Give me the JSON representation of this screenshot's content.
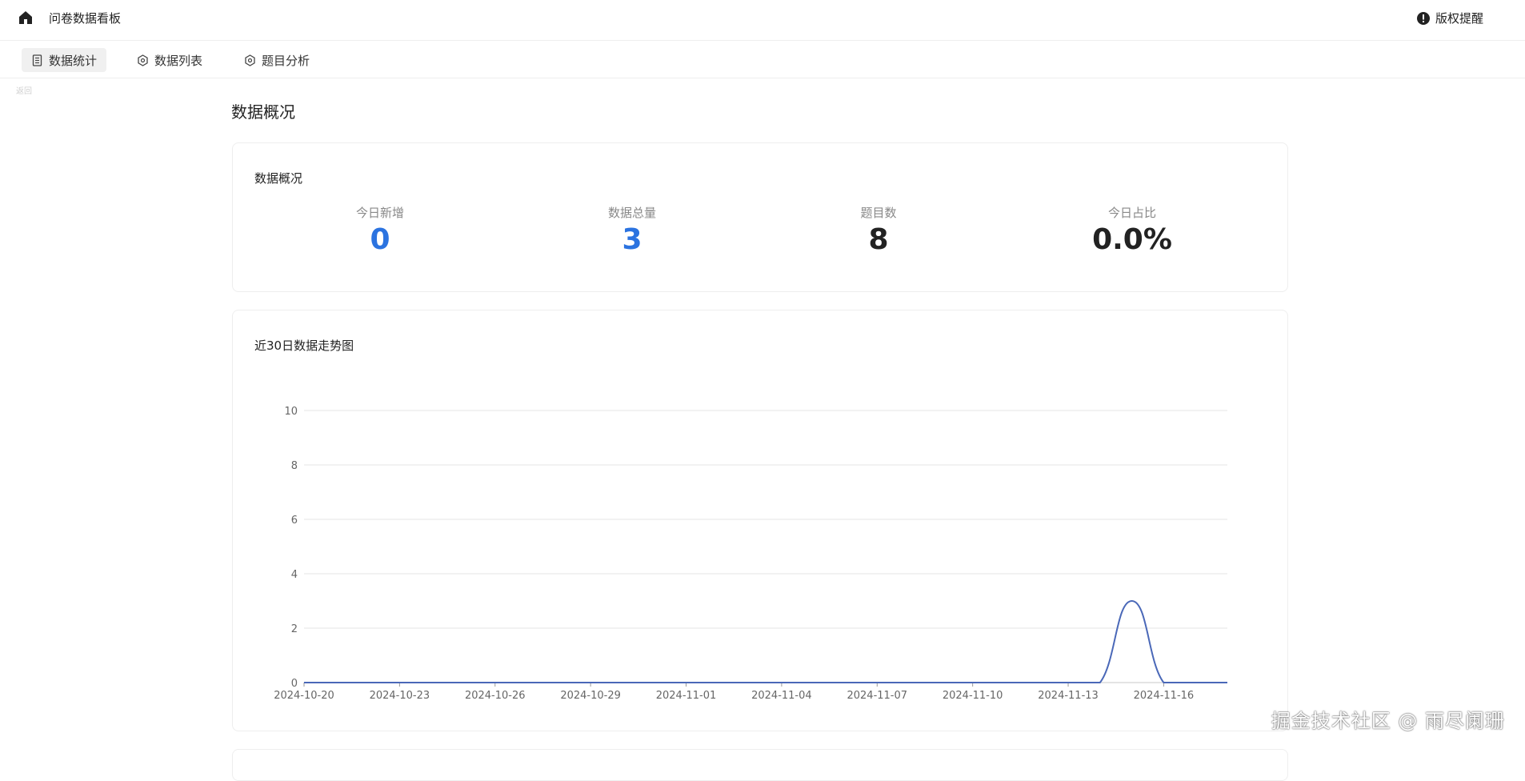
{
  "app": {
    "title": "问卷数据看板",
    "copyright_label": "版权提醒",
    "ghost_text": "返回"
  },
  "tabs": [
    {
      "label": "数据统计",
      "icon": "document-icon",
      "active": true
    },
    {
      "label": "数据列表",
      "icon": "hexagon-icon",
      "active": false
    },
    {
      "label": "题目分析",
      "icon": "hexagon-icon",
      "active": false
    }
  ],
  "page": {
    "heading": "数据概况"
  },
  "overview": {
    "title": "数据概况",
    "stats": [
      {
        "label": "今日新增",
        "value": "0",
        "color": "#2b73e0"
      },
      {
        "label": "数据总量",
        "value": "3",
        "color": "#2b73e0"
      },
      {
        "label": "题目数",
        "value": "8",
        "color": "#222222"
      },
      {
        "label": "今日占比",
        "value": "0.0%",
        "color": "#222222"
      }
    ]
  },
  "trend": {
    "title": "近30日数据走势图"
  },
  "chart_data": {
    "type": "line",
    "smooth": true,
    "title": "近30日数据走势图",
    "xlabel": "",
    "ylabel": "",
    "x": [
      "2024-10-20",
      "2024-10-21",
      "2024-10-22",
      "2024-10-23",
      "2024-10-24",
      "2024-10-25",
      "2024-10-26",
      "2024-10-27",
      "2024-10-28",
      "2024-10-29",
      "2024-10-30",
      "2024-10-31",
      "2024-11-01",
      "2024-11-02",
      "2024-11-03",
      "2024-11-04",
      "2024-11-05",
      "2024-11-06",
      "2024-11-07",
      "2024-11-08",
      "2024-11-09",
      "2024-11-10",
      "2024-11-11",
      "2024-11-12",
      "2024-11-13",
      "2024-11-14",
      "2024-11-15",
      "2024-11-16",
      "2024-11-17",
      "2024-11-18"
    ],
    "x_tick_labels": [
      "2024-10-20",
      "2024-10-23",
      "2024-10-26",
      "2024-10-29",
      "2024-11-01",
      "2024-11-04",
      "2024-11-07",
      "2024-11-10",
      "2024-11-13",
      "2024-11-16"
    ],
    "values": [
      0,
      0,
      0,
      0,
      0,
      0,
      0,
      0,
      0,
      0,
      0,
      0,
      0,
      0,
      0,
      0,
      0,
      0,
      0,
      0,
      0,
      0,
      0,
      0,
      0,
      0,
      3,
      0,
      0,
      0
    ],
    "y_ticks": [
      0,
      2,
      4,
      6,
      8,
      10
    ],
    "ylim": [
      0,
      10
    ],
    "grid": true,
    "line_color": "#4a68b8"
  },
  "watermark": "掘金技术社区 @ 雨尽阑珊"
}
